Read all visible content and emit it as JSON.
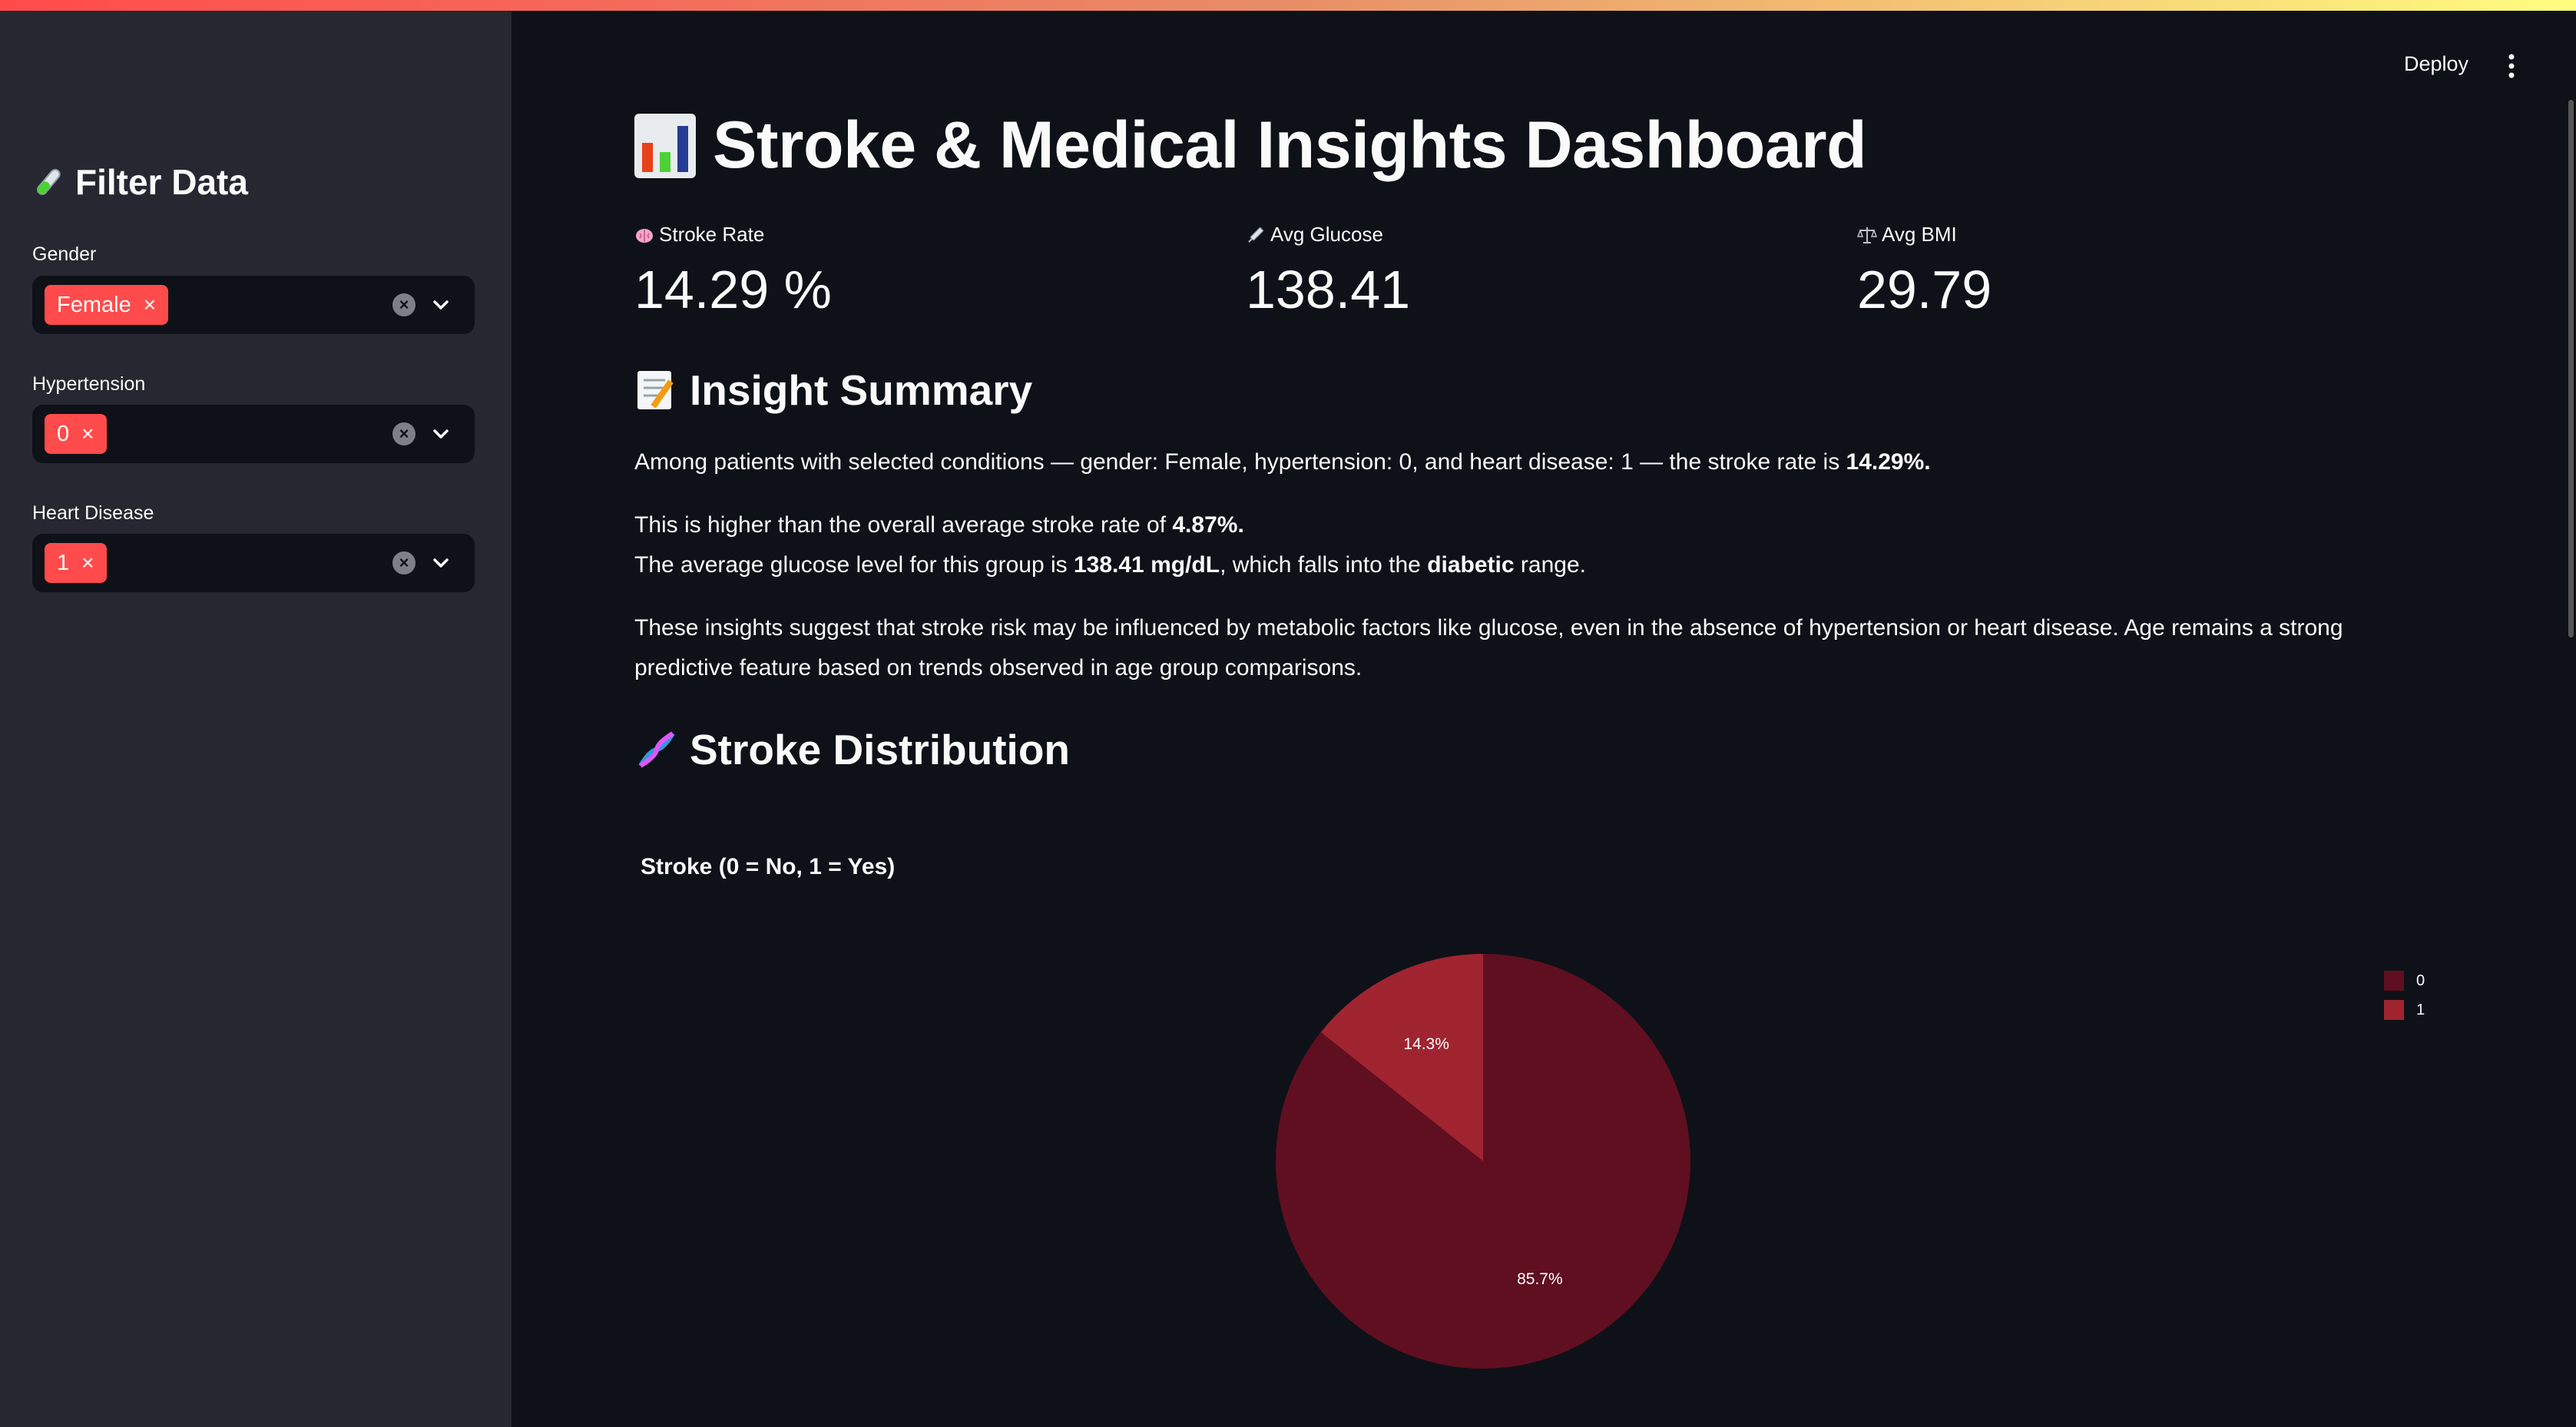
{
  "header": {
    "deploy_label": "Deploy",
    "menu_icon": "kebab-menu-icon"
  },
  "sidebar": {
    "title": "Filter Data",
    "title_icon": "test-tube-icon",
    "filters": [
      {
        "label": "Gender",
        "selected": [
          "Female"
        ]
      },
      {
        "label": "Hypertension",
        "selected": [
          "0"
        ]
      },
      {
        "label": "Heart Disease",
        "selected": [
          "1"
        ]
      }
    ],
    "tag_remove_glyph": "×",
    "clear_glyph": "×"
  },
  "main": {
    "title": "Stroke & Medical Insights Dashboard",
    "title_icon": "bar-chart-icon",
    "metrics": [
      {
        "icon": "brain-icon",
        "label": "Stroke Rate",
        "value": "14.29 %"
      },
      {
        "icon": "syringe-icon",
        "label": "Avg Glucose",
        "value": "138.41"
      },
      {
        "icon": "scales-icon",
        "label": "Avg BMI",
        "value": "29.79"
      }
    ],
    "insight_title": "Insight Summary",
    "insight_icon": "memo-icon",
    "insight": {
      "p1_text": "Among patients with selected conditions — gender: Female, hypertension: 0, and heart disease: 1 — the stroke rate is ",
      "p1_bold": "14.29%.",
      "p2_l1_text": "This is higher than the overall average stroke rate of ",
      "p2_l1_bold": "4.87%.",
      "p2_l2_a": "The average glucose level for this group is ",
      "p2_l2_bold1": "138.41 mg/dL",
      "p2_l2_b": ", which falls into the ",
      "p2_l2_bold2": "diabetic",
      "p2_l2_c": " range.",
      "p3": "These insights suggest that stroke risk may be influenced by metabolic factors like glucose, even in the absence of hypertension or heart disease. Age remains a strong predictive feature based on trends observed in age group comparisons."
    },
    "distribution_title": "Stroke Distribution",
    "distribution_icon": "dna-icon"
  },
  "colors": {
    "accent": "#ff4b4b",
    "slice_0": "#5f0f20",
    "slice_1": "#a02430"
  },
  "chart_data": {
    "type": "pie",
    "title": "Stroke (0 = No, 1 = Yes)",
    "categories": [
      "0",
      "1"
    ],
    "values": [
      85.7,
      14.3
    ],
    "labels": [
      "85.7%",
      "14.3%"
    ],
    "legend": "top-right"
  }
}
